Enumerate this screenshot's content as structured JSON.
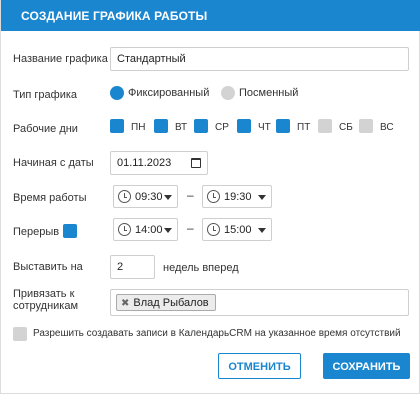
{
  "dialog": {
    "title": "СОЗДАНИЕ ГРАФИКА РАБОТЫ"
  },
  "schedule_name": {
    "label": "Название графика",
    "value": "Стандартный"
  },
  "schedule_type": {
    "label": "Тип графика",
    "options": [
      {
        "label": "Фиксированный",
        "selected": true
      },
      {
        "label": "Посменный",
        "selected": false
      }
    ]
  },
  "work_days": {
    "label": "Рабочие дни",
    "days": [
      {
        "label": "ПН",
        "checked": true
      },
      {
        "label": "ВТ",
        "checked": true
      },
      {
        "label": "СР",
        "checked": true
      },
      {
        "label": "ЧТ",
        "checked": true
      },
      {
        "label": "ПТ",
        "checked": true
      },
      {
        "label": "СБ",
        "checked": false
      },
      {
        "label": "ВС",
        "checked": false
      }
    ]
  },
  "start_date": {
    "label": "Начиная с даты",
    "value": "01.11.2023"
  },
  "work_time": {
    "label": "Время работы",
    "from": "09:30",
    "separator": "–",
    "to": "19:30"
  },
  "break_time": {
    "label": "Перерыв",
    "enabled": true,
    "from": "14:00",
    "separator": "–",
    "to": "15:00"
  },
  "weeks_ahead": {
    "label": "Выставить на",
    "value": "2",
    "suffix": "недель вперед"
  },
  "employees": {
    "label_line1": "Привязать к",
    "label_line2": "сотрудникам",
    "tags": [
      "Влад Рыбалов"
    ],
    "tag_remove": "✖"
  },
  "allow_absence": {
    "label": "Разрешить создавать записи в КалендарьCRM на указанное время отсутствий",
    "checked": false
  },
  "buttons": {
    "cancel": "ОТМЕНИТЬ",
    "save": "СОХРАНИТЬ"
  },
  "colors": {
    "accent": "#1a86cf",
    "unchecked": "#d3d3d3"
  }
}
